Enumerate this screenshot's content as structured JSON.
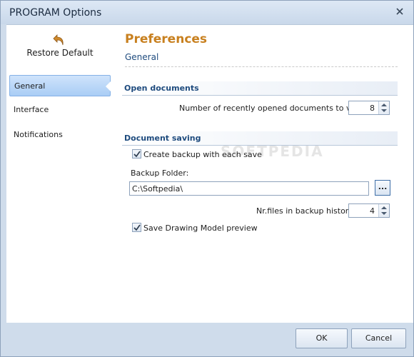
{
  "window": {
    "title": "PROGRAM Options"
  },
  "sidebar": {
    "restore_label": "Restore Default",
    "items": [
      {
        "label": "General",
        "active": true
      },
      {
        "label": "Interface",
        "active": false
      },
      {
        "label": "Notifications",
        "active": false
      }
    ]
  },
  "content": {
    "heading": "Preferences",
    "subheading": "General",
    "open_documents": {
      "title": "Open documents",
      "recent_label": "Number of recently opened documents to view:",
      "recent_value": "8"
    },
    "document_saving": {
      "title": "Document saving",
      "backup_checkbox_label": "Create backup with each save",
      "backup_checked": true,
      "backup_folder_label": "Backup Folder:",
      "backup_folder_value": "C:\\Softpedia\\",
      "browse_label": "...",
      "history_label": "Nr.files in backup history:",
      "history_value": "4",
      "preview_checkbox_label": "Save Drawing Model preview",
      "preview_checked": true
    },
    "watermark": "SOFTPEDIA"
  },
  "footer": {
    "ok_label": "OK",
    "cancel_label": "Cancel"
  },
  "colors": {
    "accent_heading": "#c8801f",
    "section_title": "#1e4b7e",
    "selection": "#a9cdf5"
  }
}
